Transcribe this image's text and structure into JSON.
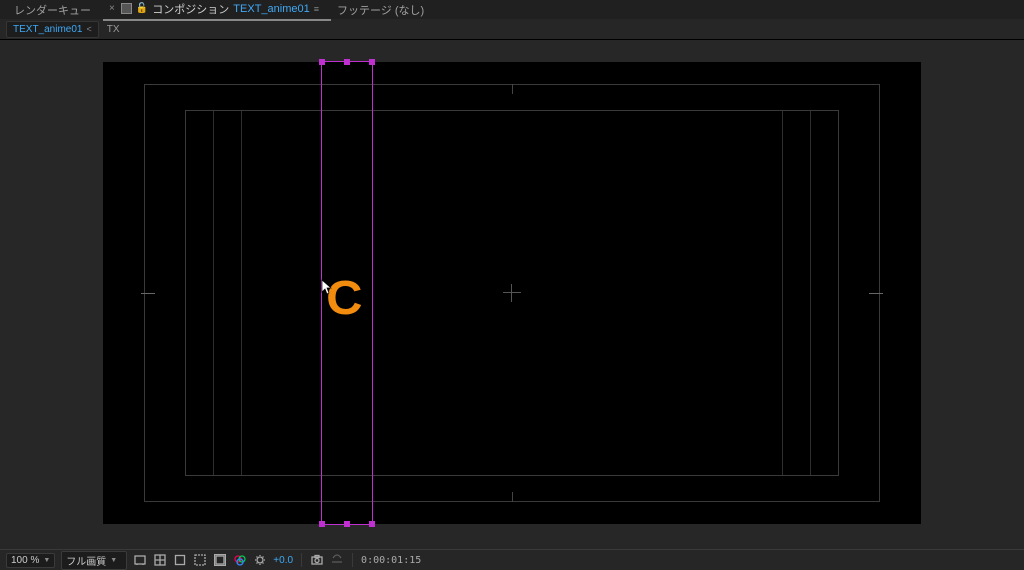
{
  "tabs": {
    "render_queue": "レンダーキュー",
    "comp_prefix": "コンポジション",
    "comp_name": "TEXT_anime01",
    "footage": "フッテージ (なし)"
  },
  "crumbs": {
    "first": "TEXT_anime01",
    "second": "TX"
  },
  "layer": {
    "character": "C"
  },
  "footer": {
    "zoom": "100 %",
    "resolution": "フル画質",
    "exposure": "+0.0",
    "timecode": "0:00:01:15"
  }
}
